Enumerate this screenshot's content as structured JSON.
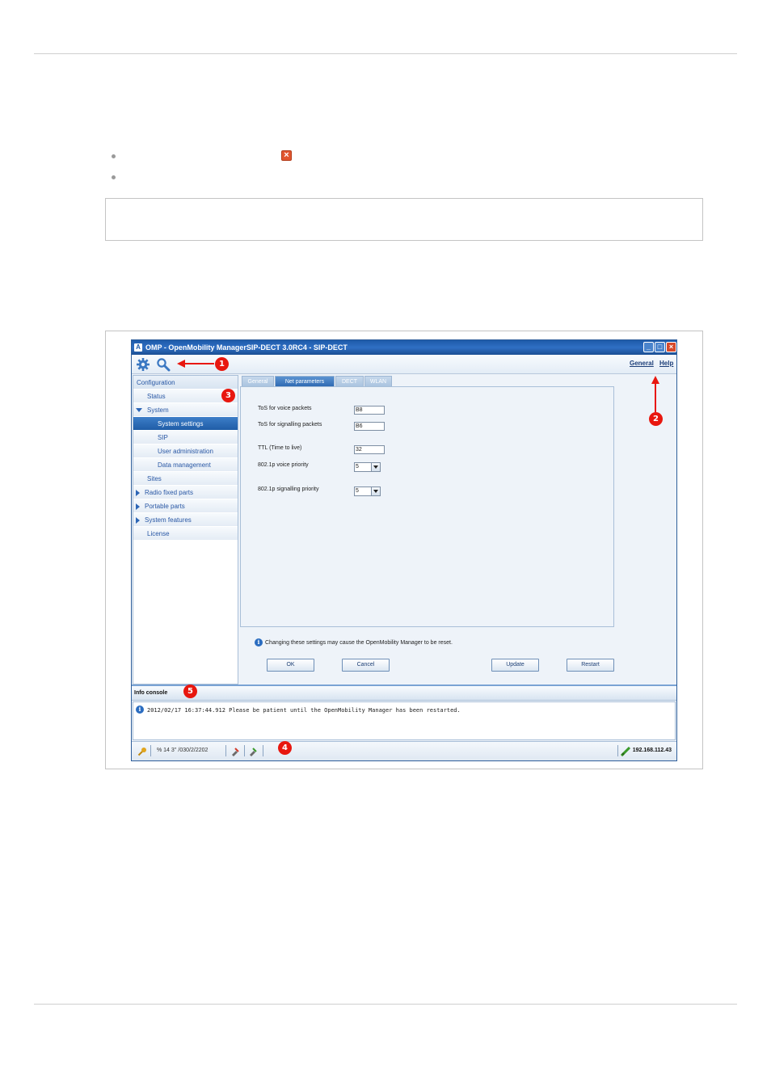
{
  "window": {
    "title": "OMP - OpenMobility ManagerSIP-DECT 3.0RC4 - SIP-DECT",
    "app_icon_letter": "A",
    "minimize_glyph": "_",
    "maximize_glyph": "□",
    "close_glyph": "×"
  },
  "toolbar": {
    "links": [
      "General",
      "Help"
    ]
  },
  "sidebar": {
    "items": [
      {
        "label": "Configuration"
      },
      {
        "label": "Status"
      },
      {
        "label": "System"
      },
      {
        "label": "System settings"
      },
      {
        "label": "SIP"
      },
      {
        "label": "User administration"
      },
      {
        "label": "Data management"
      },
      {
        "label": "Sites"
      },
      {
        "label": "Radio fixed parts"
      },
      {
        "label": "Portable parts"
      },
      {
        "label": "System features"
      },
      {
        "label": "License"
      }
    ],
    "selected": "System settings"
  },
  "tabs": [
    "General",
    "Net parameters",
    "DECT",
    "WLAN"
  ],
  "active_tab": "Net parameters",
  "form": {
    "tos_voice": {
      "label": "ToS for voice packets",
      "value": "B8"
    },
    "tos_signalling": {
      "label": "ToS for signalling packets",
      "value": "B6"
    },
    "ttl": {
      "label": "TTL (Time to live)",
      "value": "32"
    },
    "p_voice": {
      "label": "802.1p voice priority",
      "value": "5"
    },
    "p_signalling": {
      "label": "802.1p signalling priority",
      "value": "5"
    }
  },
  "info_text": "Changing these settings may cause the OpenMobility Manager to be reset.",
  "buttons": {
    "ok": "OK",
    "cancel": "Cancel",
    "update": "Update",
    "restart": "Restart"
  },
  "console": {
    "title": "Info console",
    "message": "2012/02/17 16:37:44.912 Please be patient until the OpenMobility Manager has been restarted."
  },
  "statusbar": {
    "text": "% 14 3'' /030/2/2202",
    "ip": "192.168.112.43"
  },
  "callouts": [
    "1",
    "2",
    "3",
    "4",
    "5"
  ],
  "doc": {
    "error_icon_glyph": "×"
  },
  "colors": {
    "callout": "#e8170f",
    "selection": "#2f6ab3",
    "titlebar": "#1d5aa8"
  }
}
